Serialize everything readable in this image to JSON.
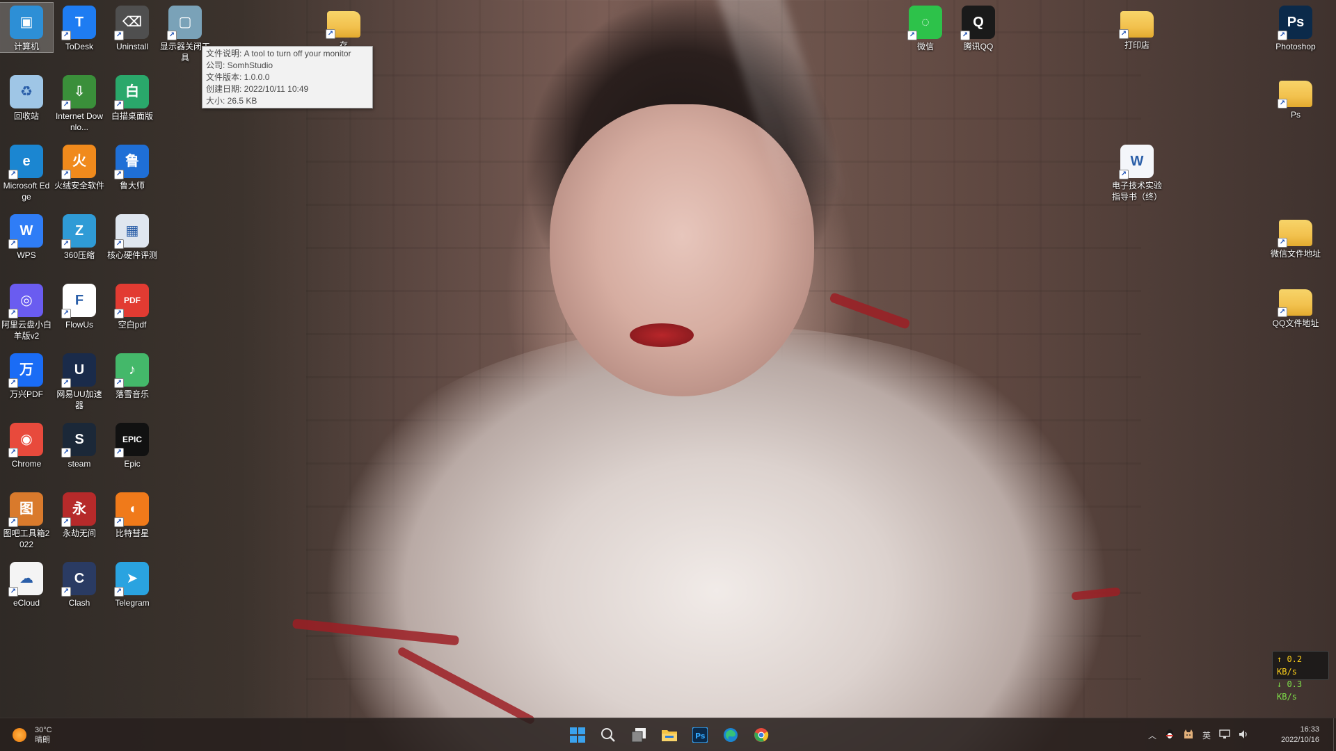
{
  "desktop": {
    "left_icons": [
      {
        "label": "计算机",
        "icon": "computer-icon",
        "color": "#2d8fd6"
      },
      {
        "label": "ToDesk",
        "icon": "todesk-icon",
        "color": "#1e7cf2"
      },
      {
        "label": "Uninstall",
        "icon": "uninstall-icon",
        "color": "#4f4f4f"
      },
      {
        "label": "显示器关闭工具",
        "icon": "monitor-tool-icon",
        "color": "#7aa2b8"
      },
      {
        "label": "回收站",
        "icon": "recycle-bin-icon",
        "color": "#9fc6e6"
      },
      {
        "label": "Internet Downlo...",
        "icon": "idm-icon",
        "color": "#3a8f3a"
      },
      {
        "label": "白描桌面版",
        "icon": "baimiao-icon",
        "color": "#2aa86b"
      },
      {
        "label": "Microsoft Edge",
        "icon": "edge-icon",
        "color": "#1b86d1"
      },
      {
        "label": "火绒安全软件",
        "icon": "huorong-icon",
        "color": "#f08a1c"
      },
      {
        "label": "鲁大师",
        "icon": "ludashi-icon",
        "color": "#1f6fd6"
      },
      {
        "label": "WPS",
        "icon": "wps-icon",
        "color": "#2f7df6"
      },
      {
        "label": "360压缩",
        "icon": "360zip-icon",
        "color": "#2f9bd6"
      },
      {
        "label": "核心硬件评测",
        "icon": "hardware-test-icon",
        "color": "#dfe6ef"
      },
      {
        "label": "阿里云盘小白羊版v2",
        "icon": "aliyun-icon",
        "color": "#6a5cf0"
      },
      {
        "label": "FlowUs",
        "icon": "flowus-icon",
        "color": "#ffffff"
      },
      {
        "label": "空白pdf",
        "icon": "pdf-icon",
        "color": "#e23b32"
      },
      {
        "label": "万兴PDF",
        "icon": "wondershare-pdf-icon",
        "color": "#1a6cf5"
      },
      {
        "label": "网易UU加速器",
        "icon": "uu-icon",
        "color": "#1a2b4a"
      },
      {
        "label": "落雪音乐",
        "icon": "luoxue-music-icon",
        "color": "#44b86a"
      },
      {
        "label": "Chrome",
        "icon": "chrome-icon",
        "color": "#e84a3c"
      },
      {
        "label": "steam",
        "icon": "steam-icon",
        "color": "#1b2838"
      },
      {
        "label": "Epic",
        "icon": "epic-icon",
        "color": "#111111"
      },
      {
        "label": "图吧工具箱2022",
        "icon": "tuba-toolbox-icon",
        "color": "#d97a2c"
      },
      {
        "label": "永劫无间",
        "icon": "naraka-icon",
        "color": "#b62a2a"
      },
      {
        "label": "比特彗星",
        "icon": "bitcomet-icon",
        "color": "#f07a1a"
      },
      {
        "label": "eCloud",
        "icon": "ecloud-icon",
        "color": "#f4f4f4"
      },
      {
        "label": "Clash",
        "icon": "clash-icon",
        "color": "#2a3b63"
      },
      {
        "label": "Telegram",
        "icon": "telegram-icon",
        "color": "#2aa3e0"
      }
    ],
    "top_folder": {
      "label": "存",
      "icon": "folder-icon",
      "color": "#f2c14e"
    },
    "right_icons": [
      {
        "label": "微信",
        "icon": "wechat-icon",
        "color": "#2dc24a"
      },
      {
        "label": "腾讯QQ",
        "icon": "qq-icon",
        "color": "#1a1a1a"
      },
      {
        "label": "打印店",
        "icon": "folder-icon",
        "color": "#f2c14e"
      },
      {
        "label": "Photoshop",
        "icon": "photoshop-icon",
        "color": "#0b2a4a"
      },
      {
        "label": "Ps",
        "icon": "folder-icon",
        "color": "#f2c14e"
      },
      {
        "label": "电子技术实验指导书（终）",
        "icon": "word-doc-icon",
        "color": "#f4f6fa"
      },
      {
        "label": "微信文件地址",
        "icon": "folder-icon",
        "color": "#f2c14e"
      },
      {
        "label": "QQ文件地址",
        "icon": "folder-icon",
        "color": "#f2c14e"
      }
    ]
  },
  "tooltip": {
    "line1": "文件说明: A tool to turn off your monitor",
    "line2": "公司: SomhStudio",
    "line3": "文件版本: 1.0.0.0",
    "line4": "创建日期: 2022/10/11 10:49",
    "line5": "大小: 26.5 KB"
  },
  "netspeed": {
    "up": "↑ 0.2 KB/s",
    "down": "↓ 0.3 KB/s"
  },
  "taskbar": {
    "weather_temp": "30°C",
    "weather_desc": "晴朗",
    "pinned": [
      "windows-start-icon",
      "search-icon",
      "task-view-icon",
      "file-explorer-icon",
      "photoshop-icon",
      "edge-icon",
      "chrome-icon"
    ],
    "tray_ime": "英",
    "clock_time": "16:33",
    "clock_date": "2022/10/16"
  }
}
